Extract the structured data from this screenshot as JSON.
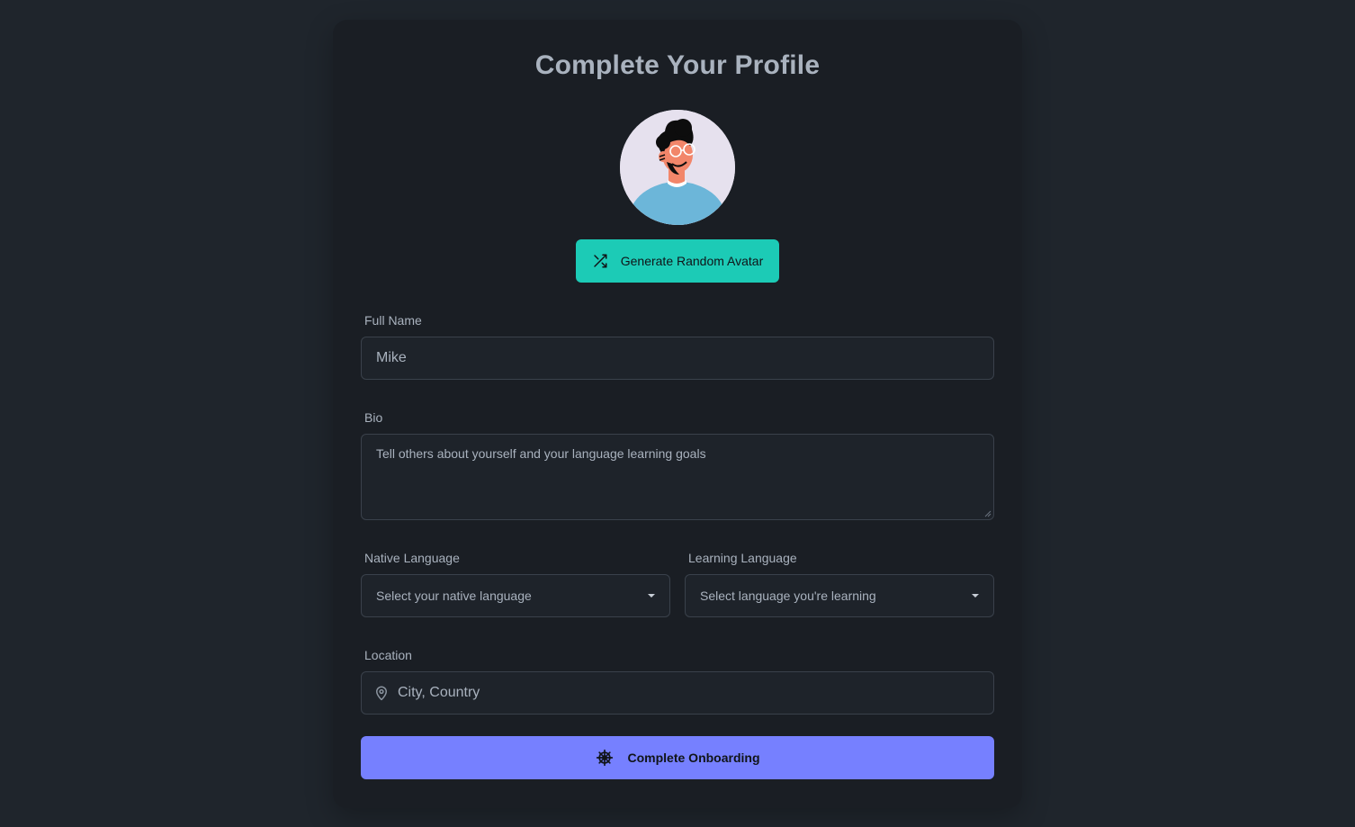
{
  "form": {
    "title": "Complete Your Profile",
    "avatar_alt": "avatar",
    "generate_avatar_label": "Generate Random Avatar",
    "full_name": {
      "label": "Full Name",
      "value": "Mike"
    },
    "bio": {
      "label": "Bio",
      "placeholder": "Tell others about yourself and your language learning goals"
    },
    "native_language": {
      "label": "Native Language",
      "selected": "Select your native language"
    },
    "learning_language": {
      "label": "Learning Language",
      "selected": "Select language you're learning"
    },
    "location": {
      "label": "Location",
      "placeholder": "City, Country"
    },
    "submit_label": "Complete Onboarding"
  },
  "icons": {
    "generate": "shuffle-icon",
    "location": "map-pin-icon",
    "submit": "ship-wheel-icon",
    "select": "chevron-down-icon"
  },
  "colors": {
    "background": "#1f252c",
    "card": "#1a1e24",
    "accent_teal": "#1ccbb6",
    "accent_primary": "#7680ff",
    "text": "#a9b2be"
  }
}
